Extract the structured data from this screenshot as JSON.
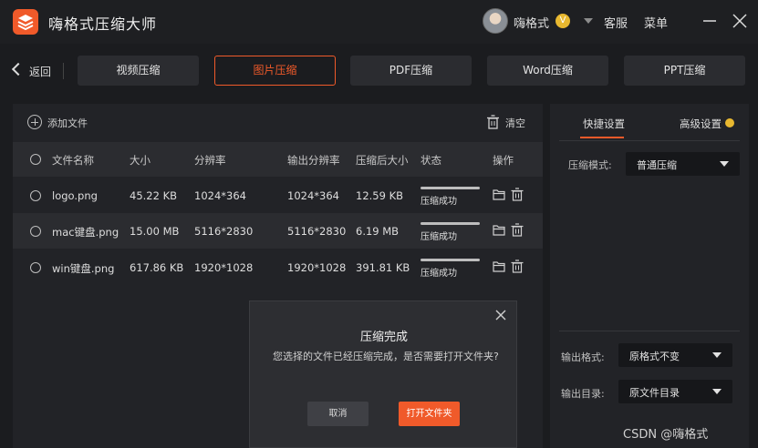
{
  "app": {
    "title": "嗨格式压缩大师",
    "user": "嗨格式",
    "vip_badge": "V",
    "service": "客服",
    "menu": "菜单"
  },
  "nav": {
    "back": "返回",
    "tabs": [
      "视频压缩",
      "图片压缩",
      "PDF压缩",
      "Word压缩",
      "PPT压缩"
    ],
    "active_tab": "图片压缩"
  },
  "filelist": {
    "add_file": "添加文件",
    "clear": "清空",
    "columns": [
      "文件名称",
      "大小",
      "分辨率",
      "输出分辨率",
      "压缩后大小",
      "状态",
      "操作"
    ],
    "rows": [
      {
        "name": "logo.png",
        "size": "45.22 KB",
        "resolution": "1024*364",
        "out_resolution": "1024*364",
        "out_size": "12.59 KB",
        "status": "压缩成功",
        "progress": 1.0
      },
      {
        "name": "mac键盘.png",
        "size": "15.00 MB",
        "resolution": "5116*2830",
        "out_resolution": "5116*2830",
        "out_size": "6.19 MB",
        "status": "压缩成功",
        "progress": 1.0
      },
      {
        "name": "win键盘.png",
        "size": "617.86 KB",
        "resolution": "1920*1028",
        "out_resolution": "1920*1028",
        "out_size": "391.81 KB",
        "status": "压缩成功",
        "progress": 1.0
      }
    ]
  },
  "settings": {
    "tab_quick": "快捷设置",
    "tab_advanced": "高级设置",
    "mode_label": "压缩模式:",
    "mode_value": "普通压缩",
    "format_label": "输出格式:",
    "format_value": "原格式不变",
    "dir_label": "输出目录:",
    "dir_value": "原文件目录"
  },
  "dialog": {
    "title": "压缩完成",
    "message": "您选择的文件已经压缩完成，是否需要打开文件夹?",
    "cancel": "取消",
    "open_folder": "打开文件夹"
  },
  "watermark": "CSDN @嗨格式",
  "colors": {
    "accent": "#f05a2a",
    "background": "#1b1c1f",
    "panel": "#222327",
    "vip_gold": "#e8b830"
  }
}
